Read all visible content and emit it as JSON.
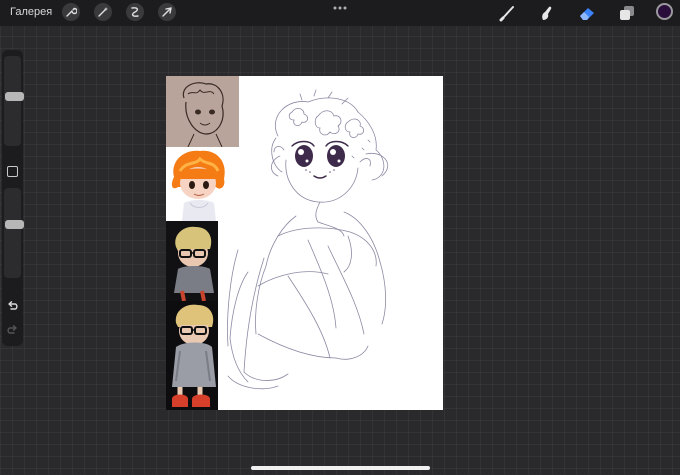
{
  "topbar": {
    "gallery_label": "Галерея",
    "left_tools": [
      "wrench-icon",
      "magic-wand-icon",
      "selection-icon",
      "transform-arrow-icon"
    ],
    "right_tools": [
      "brush-icon",
      "smudge-icon",
      "eraser-icon",
      "layers-icon"
    ],
    "active_tool": "eraser-icon",
    "current_color": "#2a0d3a",
    "accent_color": "#3b82f6"
  },
  "sidebar": {
    "brush_size_level": 0.45,
    "opacity_level": 0.4
  },
  "canvas": {
    "references": [
      "brown-sketch-reference",
      "orange-hair-character-reference",
      "3d-figure-reference-top",
      "3d-figure-reference-bottom"
    ]
  }
}
